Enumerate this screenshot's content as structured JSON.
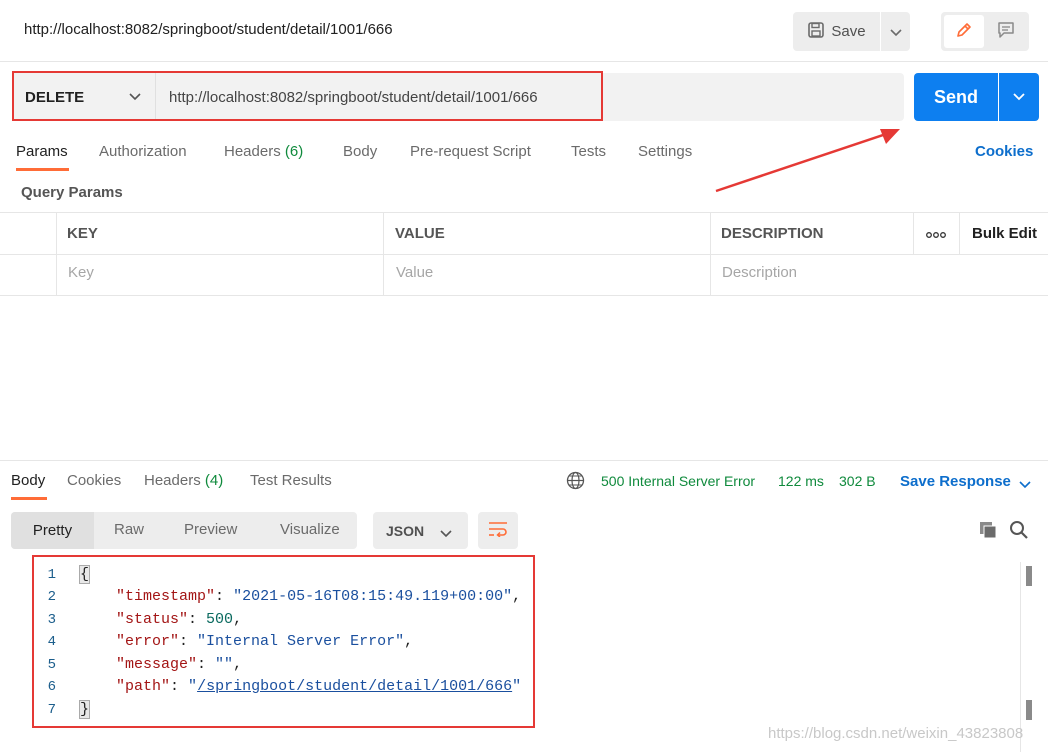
{
  "header": {
    "title": "http://localhost:8082/springboot/student/detail/1001/666",
    "save_label": "Save"
  },
  "request": {
    "method": "DELETE",
    "url": "http://localhost:8082/springboot/student/detail/1001/666",
    "send_label": "Send"
  },
  "request_tabs": {
    "params": "Params",
    "authorization": "Authorization",
    "headers": "Headers",
    "headers_count": "(6)",
    "body": "Body",
    "prerequest": "Pre-request Script",
    "tests": "Tests",
    "settings": "Settings",
    "cookies": "Cookies"
  },
  "query_params": {
    "title": "Query Params",
    "columns": [
      "KEY",
      "VALUE",
      "DESCRIPTION"
    ],
    "more_label": "ooo",
    "bulk_edit": "Bulk Edit",
    "placeholders": [
      "Key",
      "Value",
      "Description"
    ]
  },
  "response_tabs": {
    "body": "Body",
    "cookies": "Cookies",
    "headers": "Headers",
    "headers_count": "(4)",
    "test_results": "Test Results"
  },
  "response_meta": {
    "status": "500 Internal Server Error",
    "time": "122 ms",
    "size": "302 B",
    "save_response": "Save Response"
  },
  "response_toolbar": {
    "views": [
      "Pretty",
      "Raw",
      "Preview",
      "Visualize"
    ],
    "format": "JSON"
  },
  "response_body": {
    "line_numbers": [
      "1",
      "2",
      "3",
      "4",
      "5",
      "6",
      "7"
    ],
    "open_brace": "{",
    "close_brace": "}",
    "timestamp_key": "\"timestamp\"",
    "timestamp_value": "\"2021-05-16T08:15:49.119+00:00\"",
    "status_key": "\"status\"",
    "status_value": "500",
    "error_key": "\"error\"",
    "error_value": "\"Internal Server Error\"",
    "message_key": "\"message\"",
    "message_value": "\"\"",
    "path_key": "\"path\"",
    "path_value": "/springboot/student/detail/1001/666"
  },
  "watermark": "https://blog.csdn.net/weixin_43823808",
  "colors": {
    "accent_orange": "#ff6c37",
    "send_blue": "#0d7ff0",
    "link_blue": "#0d6ecc",
    "status_green": "#0f8a3c",
    "annotation_red": "#e53935"
  }
}
